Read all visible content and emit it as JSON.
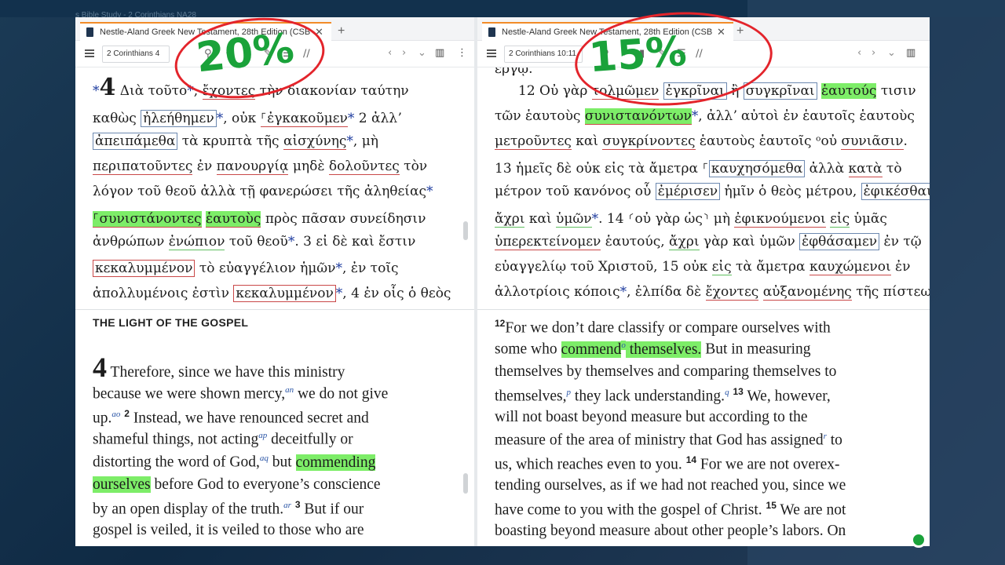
{
  "background": {
    "crumb": "s Bible Study - 2 Corinthians NA28"
  },
  "left": {
    "tab_title": "Nestle-Aland Greek New Testament, 28th Edition (CSB",
    "reference": "2 Corinthians 4",
    "greek_lines": [
      [
        "*4",
        " Διὰ τοῦτο",
        "*",
        ", ",
        "ἔχοντες",
        " τὴν διακονίαν ταύτην"
      ],
      [
        "καθὼς ",
        "ἠλεήθημεν",
        "*",
        ", οὐκ ",
        "⸀ἐγκακοῦμεν",
        "*",
        " 2 ἀλλʼ"
      ],
      [
        "ἀπειπάμεθα",
        " τὰ κρυπτὰ τῆς ",
        "αἰσχύνης",
        "*",
        ", μὴ"
      ],
      [
        "περιπατοῦντες",
        " ἐν ",
        "πανουργίᾳ",
        " μηδὲ ",
        "δολοῦντες",
        " τὸν"
      ],
      [
        "λόγον τοῦ θεοῦ ἀλλὰ τῇ φανερώσει τῆς ἀληθείας",
        "*"
      ],
      [
        "⸀συνιστάνοντες",
        " ",
        "ἑαυτοὺς",
        " πρὸς πᾶσαν συνείδησιν"
      ],
      [
        "ἀνθρώπων ",
        "ἐνώπιον",
        " τοῦ θεοῦ",
        "*",
        ". 3 εἰ δὲ καὶ ἔστιν"
      ],
      [
        "κεκαλυμμένον",
        " τὸ εὐαγγέλιον ἡμῶν",
        "*",
        ", ἐν τοῖς"
      ],
      [
        "ἀπολλυμένοις ἐστὶν ",
        "κεκαλυμμένον",
        "*",
        ", 4 ἐν οἷς ὁ θεὸς"
      ]
    ],
    "section_heading": "THE LIGHT OF THE GOSPEL",
    "eng": {
      "chapter": "4",
      "l1": "Therefore, since we have this ministry",
      "l2a": "because we were shown mercy,",
      "fn_an": "an",
      "l2b": " we do not give",
      "l3a": "up.",
      "fn_ao": "ao",
      "v2": "2",
      "l3b": " Instead, we have renounced secret and",
      "l4": "shameful things, not acting",
      "fn_ap": "ap",
      "l4b": " deceitfully or",
      "l5a": "distorting the word of God,",
      "fn_aq": "aq",
      "l5b": " but ",
      "l5hl": "commending",
      "l6hl": "ourselves",
      "l6b": " before God to everyone’s conscience",
      "l7a": "by an open display of the truth.",
      "fn_ar": "ar",
      "v3": "3",
      "l7b": " But if our",
      "l8": "gospel is veiled, it is veiled to those who are"
    }
  },
  "right": {
    "tab_title": "Nestle-Aland Greek New Testament, 28th Edition (CSB",
    "reference": "2 Corinthians 10:11",
    "greek_lines": [
      [
        "ἔργῳ."
      ],
      [
        "12 Οὐ γὰρ ",
        "τολμῶμεν",
        " ",
        "ἐγκρῖναι",
        " ἢ ",
        "συγκρῖναι",
        " ",
        "ἑαυτούς",
        " τισιν"
      ],
      [
        "τῶν ἑαυτοὺς ",
        "συνιστανόντων",
        "*",
        ", ἀλλʼ αὐτοὶ ἐν ἑαυτοῖς ἑαυτοὺς"
      ],
      [
        "μετροῦντες",
        " καὶ ",
        "συγκρίνοντες",
        " ἑαυτοὺς ἑαυτοῖς ",
        "ᵒοὐ ",
        "συνιᾶσιν",
        "."
      ],
      [
        "13 ἡμεῖς δὲ ",
        "οὐκ εἰς τὰ ἄμετρα ⸀",
        "καυχησόμεθα",
        " ἀλλὰ ",
        "κατὰ",
        " τὸ"
      ],
      [
        "μέτρον τοῦ κανόνος οὗ ",
        "ἐμέρισεν",
        " ἡμῖν ὁ θεὸς μέτρου, ",
        "ἐφικέσθαι"
      ],
      [
        "ἄχρι",
        " καὶ ",
        "ὑμῶν",
        "*",
        ". 14 ⸂οὐ γὰρ ὡς⸃ μὴ ",
        "ἐφικνούμενοι",
        " ",
        "εἰς",
        " ὑμᾶς"
      ],
      [
        "ὑπερεκτείνομεν",
        " ἑαυτούς, ",
        "ἄχρι",
        " γὰρ καὶ ὑμῶν ",
        "ἐφθάσαμεν",
        " ἐν τῷ"
      ],
      [
        "εὐαγγελίῳ τοῦ Χριστοῦ, 15 οὐκ ",
        "εἰς",
        " τὰ ἄμετρα ",
        "καυχώμενοι",
        " ἐν"
      ],
      [
        "ἀλλοτρίοις κόποις",
        "*",
        ", ἐλπίδα δὲ ",
        "ἔχοντες",
        " ",
        "αὐξανομένης",
        " τῆς ",
        "πίστεως"
      ]
    ],
    "eng": {
      "v12": "12",
      "l1": "For we don’t dare classify or compare ourselves with",
      "l2a": "some who ",
      "l2hl": "commend",
      "fn_o": "o",
      "l2hl2": " themselves.",
      "l2b": " But in measuring",
      "l3": "themselves by themselves and comparing themselves to",
      "l4a": "themselves,",
      "fn_p": "p",
      "l4b": " they lack understanding.",
      "fn_q": "q",
      "v13": "13",
      "l4c": " We, however,",
      "l5": "will not boast beyond measure but according to the",
      "l6a": "measure of the area of ministry that God has assigned",
      "fn_r": "r",
      "l6b": " to",
      "l7a": "us, which reaches even to you. ",
      "v14": "14",
      "l7b": " For we are not overex-",
      "l8": "tending ourselves, as if we had not reached you, since we",
      "l9a": "have come to you with the gospel of Christ. ",
      "v15": "15",
      "l9b": " We are not",
      "l10": "boasting beyond measure about other people’s labors. On"
    }
  },
  "annotations": {
    "left_zoom": "20%",
    "right_zoom": "15%"
  }
}
